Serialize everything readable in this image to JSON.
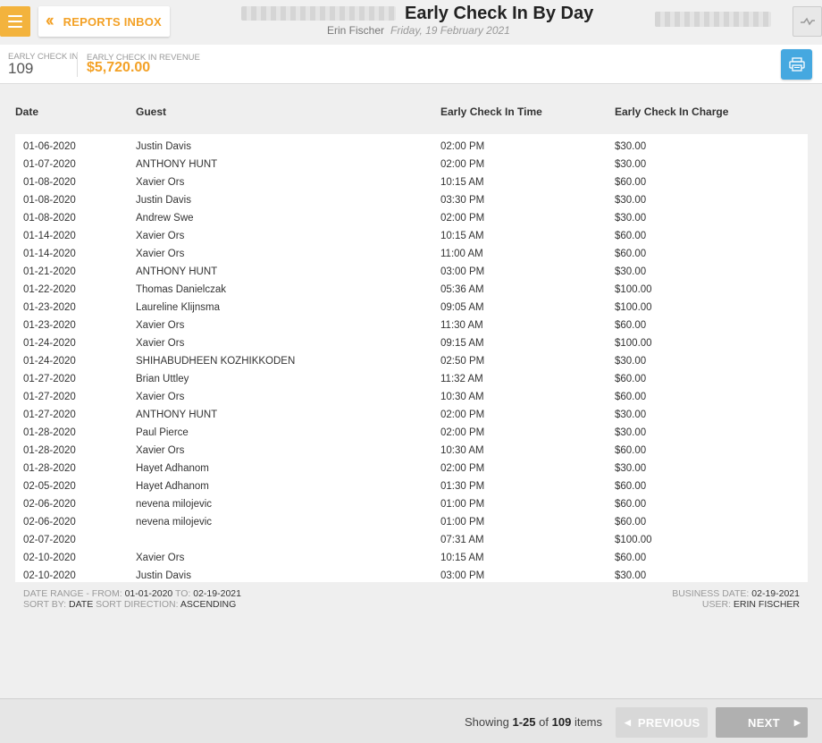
{
  "header": {
    "reports_inbox_label": "REPORTS INBOX",
    "title": "Early Check In By Day",
    "user": "Erin Fischer",
    "date": "Friday, 19 February 2021"
  },
  "summary": {
    "early_check_in_label": "EARLY CHECK IN",
    "early_check_in_value": "109",
    "revenue_label": "EARLY CHECK IN REVENUE",
    "revenue_value": "$5,720.00"
  },
  "table": {
    "columns": [
      "Date",
      "Guest",
      "Early Check In Time",
      "Early Check In Charge"
    ],
    "rows": [
      [
        "01-06-2020",
        "Justin Davis",
        "02:00 PM",
        "$30.00"
      ],
      [
        "01-07-2020",
        "ANTHONY HUNT",
        "02:00 PM",
        "$30.00"
      ],
      [
        "01-08-2020",
        "Xavier Ors",
        "10:15 AM",
        "$60.00"
      ],
      [
        "01-08-2020",
        "Justin Davis",
        "03:30 PM",
        "$30.00"
      ],
      [
        "01-08-2020",
        "Andrew Swe",
        "02:00 PM",
        "$30.00"
      ],
      [
        "01-14-2020",
        "Xavier Ors",
        "10:15 AM",
        "$60.00"
      ],
      [
        "01-14-2020",
        "Xavier Ors",
        "11:00 AM",
        "$60.00"
      ],
      [
        "01-21-2020",
        "ANTHONY HUNT",
        "03:00 PM",
        "$30.00"
      ],
      [
        "01-22-2020",
        "Thomas Danielczak",
        "05:36 AM",
        "$100.00"
      ],
      [
        "01-23-2020",
        "Laureline Klijnsma",
        "09:05 AM",
        "$100.00"
      ],
      [
        "01-23-2020",
        "Xavier Ors",
        "11:30 AM",
        "$60.00"
      ],
      [
        "01-24-2020",
        "Xavier Ors",
        "09:15 AM",
        "$100.00"
      ],
      [
        "01-24-2020",
        "SHIHABUDHEEN KOZHIKKODEN",
        "02:50 PM",
        "$30.00"
      ],
      [
        "01-27-2020",
        "Brian Uttley",
        "11:32 AM",
        "$60.00"
      ],
      [
        "01-27-2020",
        "Xavier Ors",
        "10:30 AM",
        "$60.00"
      ],
      [
        "01-27-2020",
        "ANTHONY HUNT",
        "02:00 PM",
        "$30.00"
      ],
      [
        "01-28-2020",
        "Paul Pierce",
        "02:00 PM",
        "$30.00"
      ],
      [
        "01-28-2020",
        "Xavier Ors",
        "10:30 AM",
        "$60.00"
      ],
      [
        "01-28-2020",
        "Hayet Adhanom",
        "02:00 PM",
        "$30.00"
      ],
      [
        "02-05-2020",
        "Hayet Adhanom",
        "01:30 PM",
        "$60.00"
      ],
      [
        "02-06-2020",
        "nevena milojevic",
        "01:00 PM",
        "$60.00"
      ],
      [
        "02-06-2020",
        "nevena milojevic",
        "01:00 PM",
        "$60.00"
      ],
      [
        "02-07-2020",
        "",
        "07:31 AM",
        "$100.00"
      ],
      [
        "02-10-2020",
        "Xavier Ors",
        "10:15 AM",
        "$60.00"
      ],
      [
        "02-10-2020",
        "Justin Davis",
        "03:00 PM",
        "$30.00"
      ]
    ]
  },
  "meta": {
    "date_range_label": "DATE RANGE - FROM:",
    "from": "01-01-2020",
    "to_label": "TO:",
    "to": "02-19-2021",
    "sort_by_label": "SORT BY:",
    "sort_by": "DATE",
    "sort_dir_label": "SORT DIRECTION:",
    "sort_dir": "ASCENDING",
    "business_date_label": "BUSINESS DATE:",
    "business_date": "02-19-2021",
    "user_label": "USER:",
    "user": "ERIN FISCHER"
  },
  "pagination": {
    "showing_prefix": "Showing",
    "range": "1-25",
    "of_label": "of",
    "total": "109",
    "items_label": "items",
    "previous_label": "PREVIOUS",
    "next_label": "NEXT"
  },
  "icons": {
    "menu": "hamburger-icon",
    "back": "double-chevron-left-icon",
    "graph": "line-graph-icon",
    "print": "printer-icon",
    "prev": "triangle-left-icon",
    "next": "triangle-right-icon"
  },
  "colors": {
    "accent": "#f3a126",
    "menu_bg": "#f3b33d",
    "print_bg": "#45a8e0"
  }
}
